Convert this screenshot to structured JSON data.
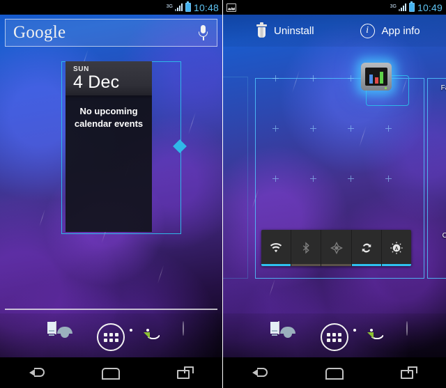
{
  "left_panel": {
    "status_bar": {
      "network_type": "3G",
      "signal_icon": "signal-bars-icon",
      "battery_icon": "battery-icon",
      "time": "10:48"
    },
    "search_widget": {
      "logo_text": "Google",
      "mic_icon": "microphone-icon"
    },
    "calendar_widget": {
      "day_of_week": "SUN",
      "date": "4 Dec",
      "empty_message_line1": "No upcoming",
      "empty_message_line2": "calendar events",
      "resize_handle_icon": "resize-handle-diamond-icon",
      "frame_color": "#2fb8e8"
    },
    "dock": {
      "items": [
        {
          "name": "phone",
          "icon": "phone-icon"
        },
        {
          "name": "contacts",
          "icon": "contacts-icon"
        },
        {
          "name": "all-apps",
          "icon": "app-drawer-icon"
        },
        {
          "name": "messaging",
          "icon": "messaging-icon"
        },
        {
          "name": "browser",
          "icon": "browser-globe-icon"
        }
      ]
    },
    "nav_bar": {
      "back_icon": "back-icon",
      "home_icon": "home-icon",
      "recents_icon": "recents-icon"
    }
  },
  "right_panel": {
    "status_bar": {
      "notification_icon": "screenshot-image-icon",
      "network_type": "3G",
      "signal_icon": "signal-bars-icon",
      "battery_icon": "battery-icon",
      "time": "10:49"
    },
    "action_bar": {
      "uninstall_label": "Uninstall",
      "uninstall_icon": "trash-icon",
      "app_info_label": "App info",
      "app_info_icon": "info-icon"
    },
    "dragged_widget": {
      "icon": "bar-chart-widget-icon",
      "bar_colors": [
        "#4f8fe8",
        "#e24a4a",
        "#5fd24a"
      ],
      "glow_color": "#46c8ff"
    },
    "power_control_widget": {
      "toggles": [
        {
          "name": "wifi",
          "icon": "wifi-icon",
          "state": "on"
        },
        {
          "name": "bluetooth",
          "icon": "bluetooth-icon",
          "state": "off"
        },
        {
          "name": "gps",
          "icon": "gps-icon",
          "state": "off"
        },
        {
          "name": "sync",
          "icon": "sync-icon",
          "state": "on"
        },
        {
          "name": "brightness",
          "icon": "brightness-auto-icon",
          "state": "on"
        }
      ],
      "on_color": "#2ec2f0",
      "off_color": "#5a5248"
    },
    "peek_apps": [
      {
        "label": "Fac",
        "icon": "facebook-icon"
      },
      {
        "label": "Ca",
        "icon": "camera-icon"
      }
    ],
    "dock": {
      "items": [
        {
          "name": "phone",
          "icon": "phone-icon"
        },
        {
          "name": "contacts",
          "icon": "contacts-icon"
        },
        {
          "name": "all-apps",
          "icon": "app-drawer-icon"
        },
        {
          "name": "messaging",
          "icon": "messaging-icon"
        },
        {
          "name": "browser",
          "icon": "browser-globe-icon"
        }
      ]
    },
    "nav_bar": {
      "back_icon": "back-icon",
      "home_icon": "home-icon",
      "recents_icon": "recents-icon"
    }
  }
}
